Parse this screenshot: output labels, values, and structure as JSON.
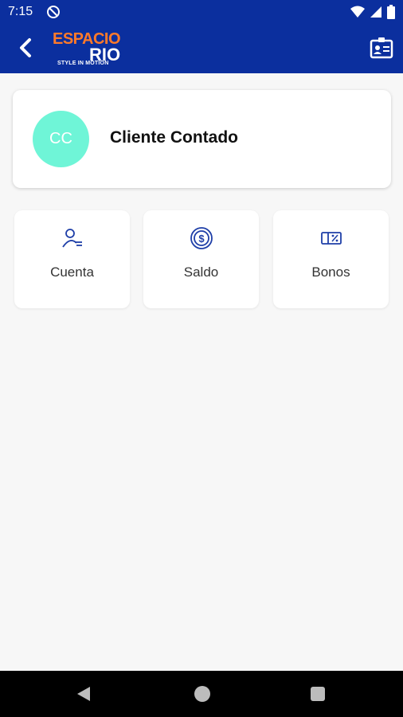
{
  "status_bar": {
    "time": "7:15"
  },
  "app_bar": {
    "logo": {
      "line1": "ESPACIO",
      "line2": "RIO",
      "tagline": "STYLE IN MOTION"
    }
  },
  "profile": {
    "initials": "CC",
    "name": "Cliente Contado",
    "avatar_color": "#6ff5d7"
  },
  "tiles": [
    {
      "label": "Cuenta",
      "icon": "user-list-icon"
    },
    {
      "label": "Saldo",
      "icon": "dollar-coin-icon"
    },
    {
      "label": "Bonos",
      "icon": "voucher-icon"
    }
  ],
  "colors": {
    "primary": "#0b2f9e",
    "icon_blue": "#1f3fa8"
  }
}
